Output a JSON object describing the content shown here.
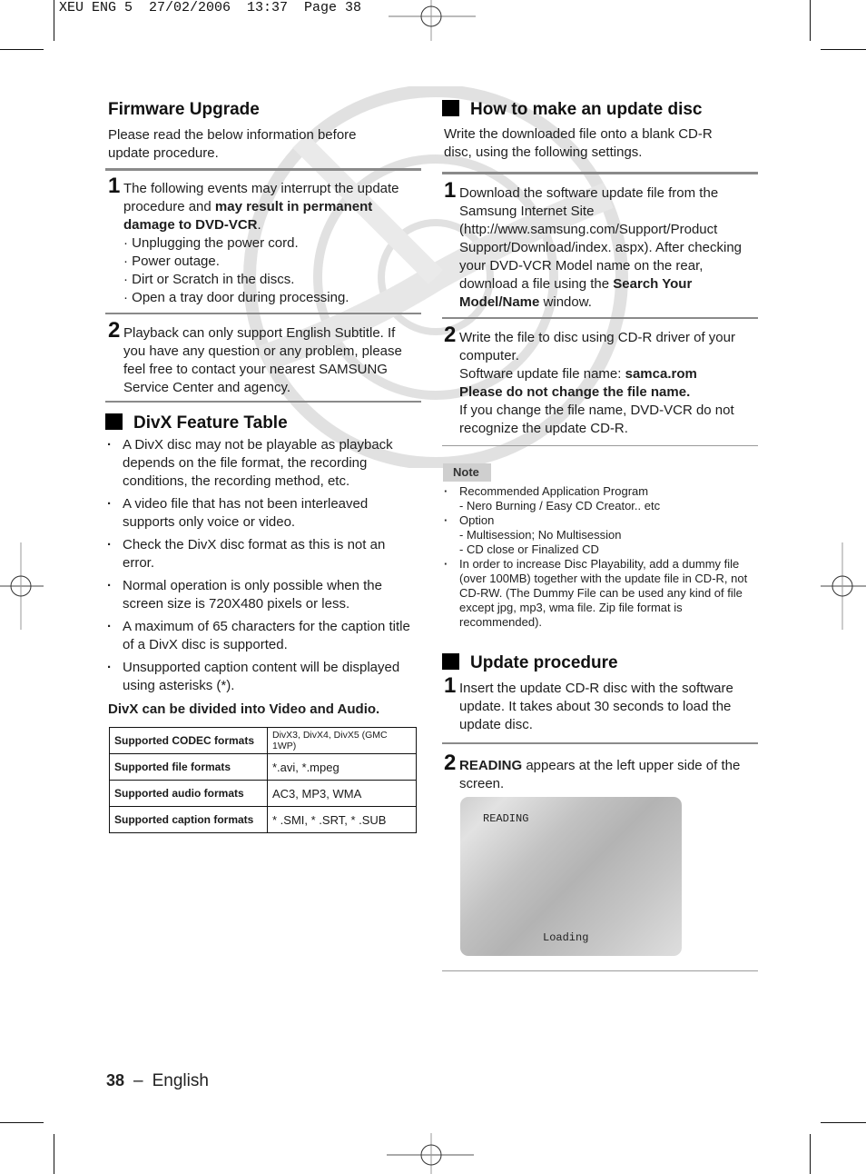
{
  "slug": "XEU ENG 5  27/02/2006  13:37  Page 38",
  "firmware": {
    "title": "Firmware Upgrade",
    "intro": "Please read the below information before update procedure.",
    "step1": {
      "num": "1",
      "text_pre": "The following events may interrupt the update procedure and ",
      "text_bold": "may result in permanent damage to DVD-VCR",
      "text_post": ".",
      "bullets": [
        "Unplugging the power cord.",
        "Power outage.",
        "Dirt or Scratch in the discs.",
        "Open a tray door during processing."
      ]
    },
    "step2": {
      "num": "2",
      "text": "Playback can only support English Subtitle. If you have any question or any problem, please feel free to contact your nearest SAMSUNG Service Center and agency."
    }
  },
  "divx": {
    "title": "DivX Feature Table",
    "bullets": [
      "A DivX disc may not be playable as playback depends on the file format, the recording conditions, the recording method, etc.",
      "A video file that has not been interleaved supports only voice or video.",
      "Check the DivX disc format as this is not an error.",
      "Normal operation is only possible when the screen size is 720X480 pixels or less.",
      "A maximum of 65 characters for the caption title of a DivX disc is supported.",
      "Unsupported caption content will be displayed using asterisks (*)."
    ],
    "summary": "DivX can be divided into Video and Audio.",
    "table": [
      {
        "key": "Supported CODEC formats",
        "value": "DivX3, DivX4, DivX5 (GMC 1WP)"
      },
      {
        "key": "Supported file formats",
        "value": "*.avi, *.mpeg"
      },
      {
        "key": "Supported audio formats",
        "value": "AC3, MP3, WMA"
      },
      {
        "key": "Supported caption formats",
        "value": "* .SMI, * .SRT, * .SUB"
      }
    ]
  },
  "update_disc": {
    "title": "How to make an update disc",
    "intro": "Write the downloaded file onto a blank CD-R disc, using the following settings.",
    "step1": {
      "num": "1",
      "text_pre": "Download the software update file from the Samsung Internet Site (http://www.samsung.com/Support/Product Support/Download/index. aspx). After checking your DVD-VCR Model name on the rear, download a file using the ",
      "text_bold": "Search Your Model/Name",
      "text_post": " window."
    },
    "step2": {
      "num": "2",
      "line1": "Write the file to disc using CD-R driver of your computer.",
      "file_label": "Software update file name: ",
      "file_name": "samca.rom",
      "warning": "Please do not change the file name.",
      "line3": "If you change the file name, DVD-VCR do not recognize the update CD-R."
    }
  },
  "note": {
    "label": "Note",
    "items": [
      {
        "text": "Recommended Application Program",
        "subs": [
          "- Nero Burning / Easy CD Creator.. etc"
        ]
      },
      {
        "text": "Option",
        "subs": [
          "- Multisession; No Multisession",
          "- CD close or Finalized CD"
        ]
      },
      {
        "text": "In order to increase Disc Playability, add a dummy file (over 100MB) together with the update file in CD-R, not CD-RW. (The Dummy File can be used any kind of file except jpg, mp3, wma file. Zip file format is recommended).",
        "subs": []
      }
    ]
  },
  "update_procedure": {
    "title": "Update procedure",
    "step1": {
      "num": "1",
      "text": "Insert the update CD-R disc with the software update. It takes about 30 seconds to load the update disc."
    },
    "step2": {
      "num": "2",
      "text_bold": "READING",
      "text_post": " appears at the left upper side of the screen."
    },
    "screen": {
      "top_label": "READING",
      "bottom_label": "Loading"
    }
  },
  "footer": {
    "page_number": "38",
    "separator": "–",
    "language": "English"
  }
}
